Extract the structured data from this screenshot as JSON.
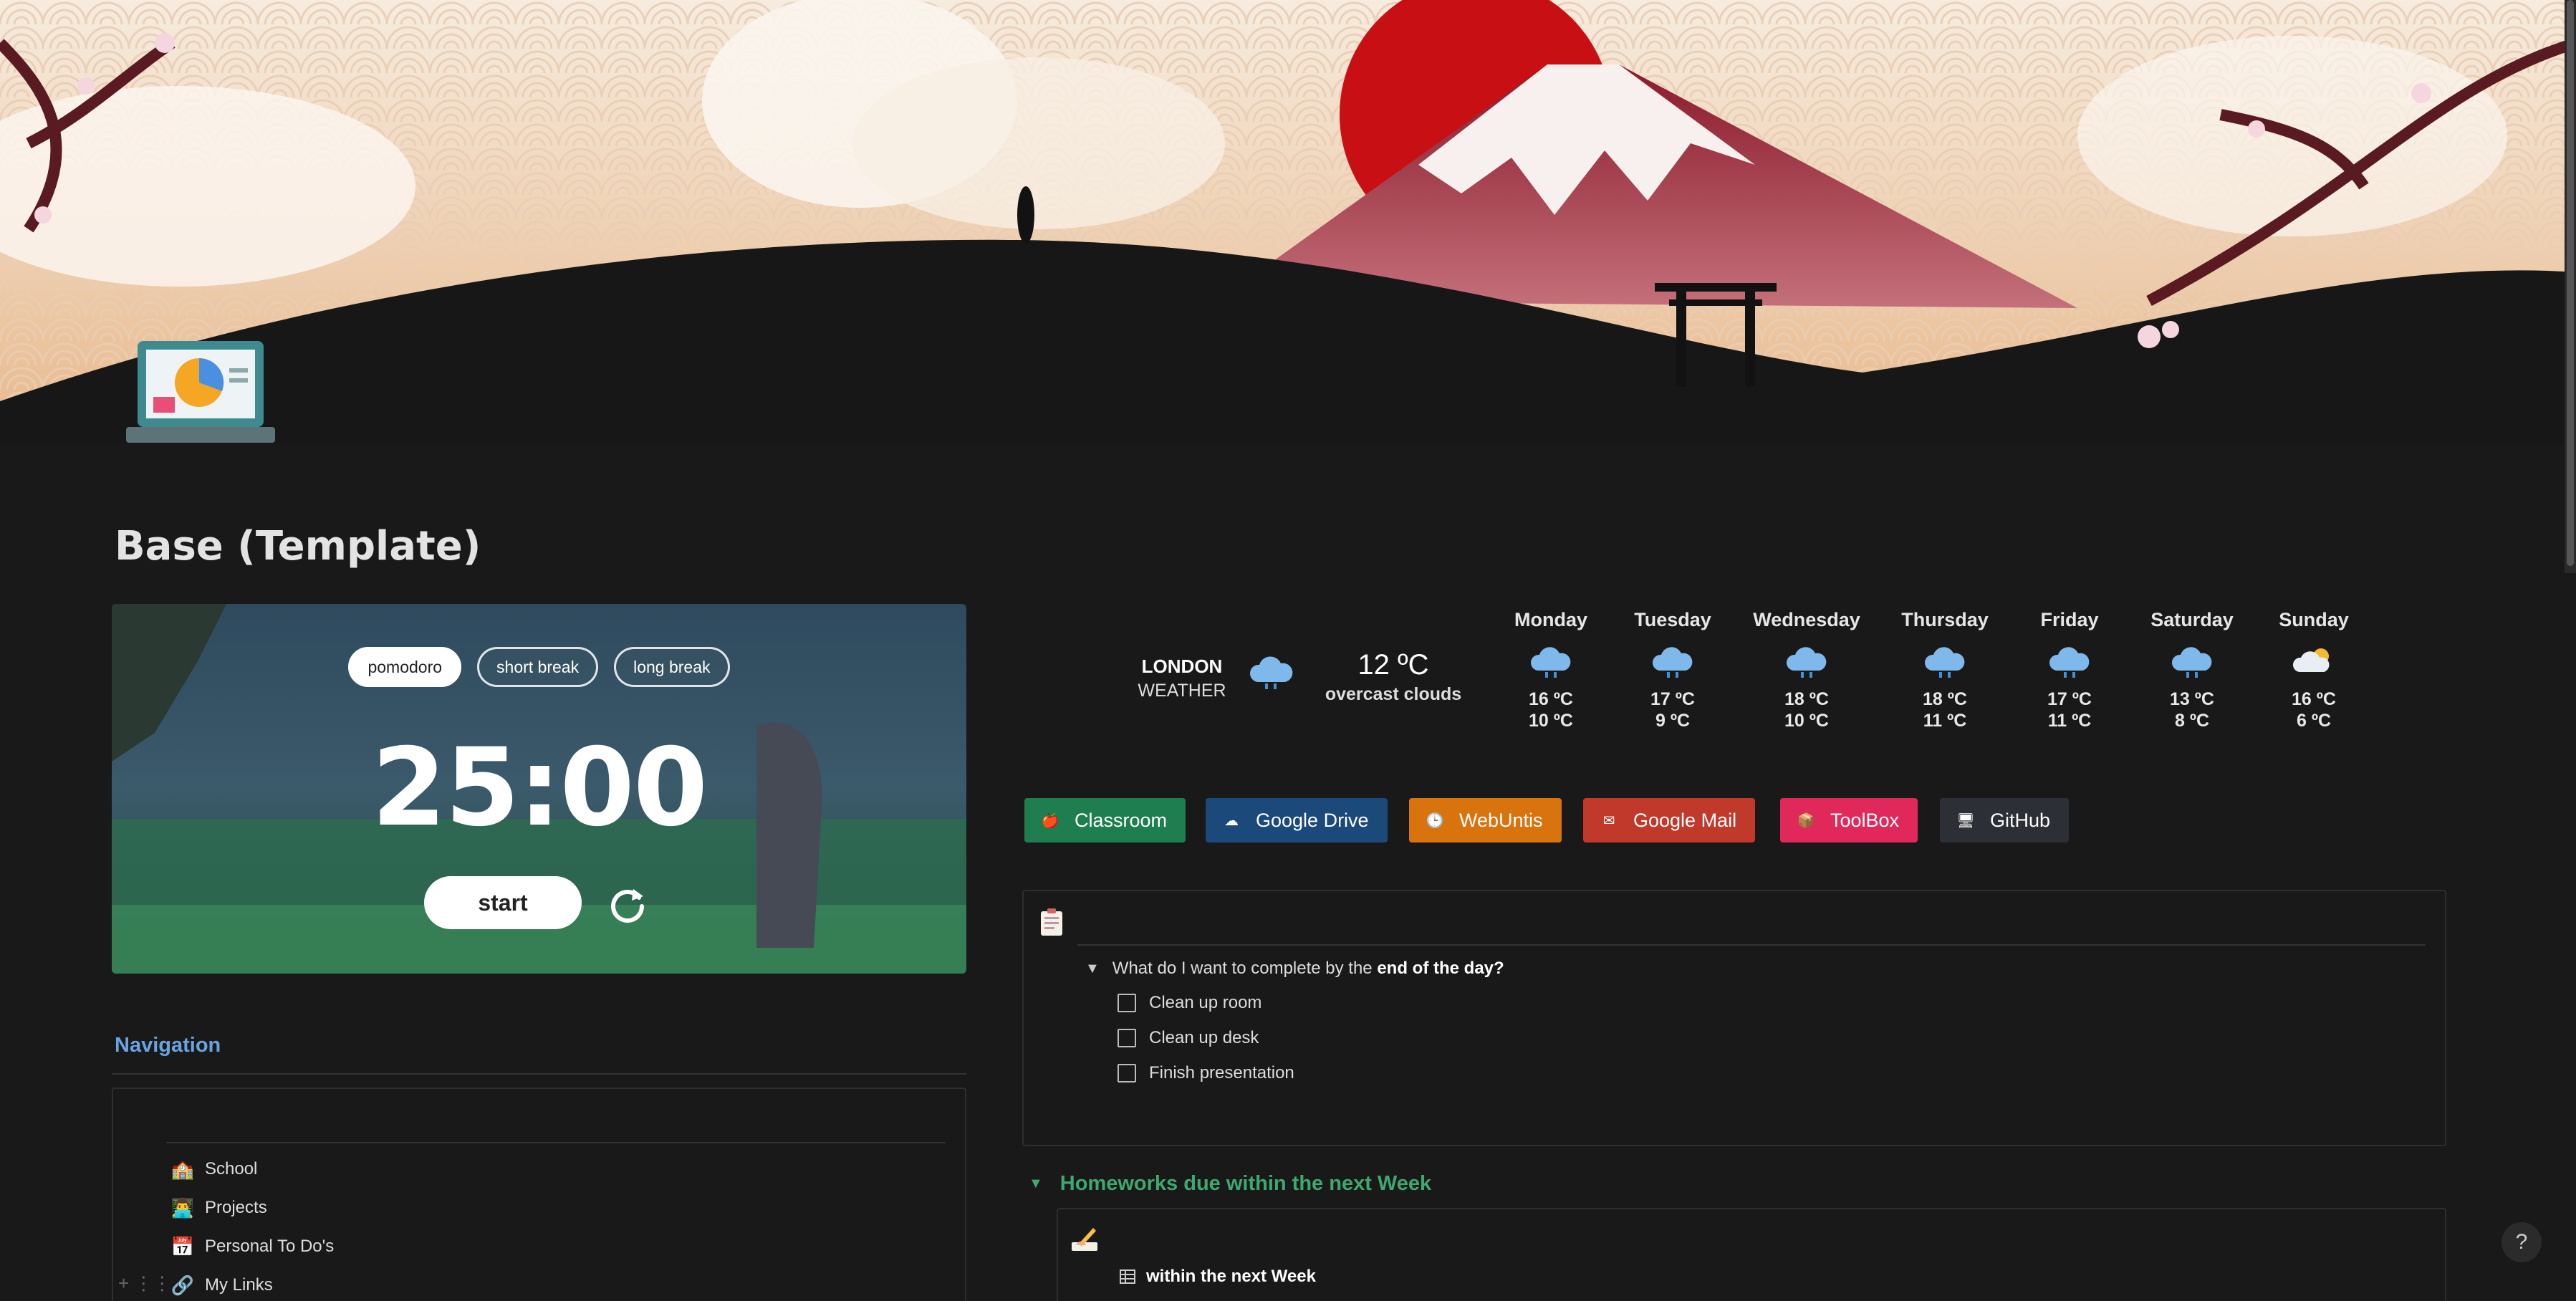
{
  "page": {
    "title": "Base (Template)"
  },
  "pomodoro": {
    "modes": [
      "pomodoro",
      "short break",
      "long break"
    ],
    "active_mode": "pomodoro",
    "time": "25:00",
    "start_label": "start"
  },
  "navigation": {
    "heading": "Navigation",
    "items": [
      {
        "label": "School",
        "icon": "school-icon"
      },
      {
        "label": "Projects",
        "icon": "projects-icon"
      },
      {
        "label": "Personal To Do's",
        "icon": "calendar-icon"
      },
      {
        "label": "My Links",
        "icon": "link-icon"
      }
    ]
  },
  "weather": {
    "city": "LONDON",
    "label": "WEATHER",
    "current_temp": "12 ºC",
    "current_desc": "overcast clouds",
    "days": [
      {
        "name": "Monday",
        "hi": "16 ºC",
        "lo": "10 ºC",
        "icon": "rain-cloud-icon"
      },
      {
        "name": "Tuesday",
        "hi": "17 ºC",
        "lo": "9 ºC",
        "icon": "rain-cloud-icon"
      },
      {
        "name": "Wednesday",
        "hi": "18 ºC",
        "lo": "10 ºC",
        "icon": "rain-cloud-icon"
      },
      {
        "name": "Thursday",
        "hi": "18 ºC",
        "lo": "11 ºC",
        "icon": "rain-cloud-icon"
      },
      {
        "name": "Friday",
        "hi": "17 ºC",
        "lo": "11 ºC",
        "icon": "rain-cloud-icon"
      },
      {
        "name": "Saturday",
        "hi": "13 ºC",
        "lo": "8 ºC",
        "icon": "rain-cloud-icon"
      },
      {
        "name": "Sunday",
        "hi": "16 ºC",
        "lo": "6 ºC",
        "icon": "sun-cloud-icon"
      }
    ]
  },
  "quick_links": [
    {
      "label": "Classroom",
      "color": "#1e7e4f",
      "icon": "apple-icon"
    },
    {
      "label": "Google Drive",
      "color": "#1b4a7a",
      "icon": "cloud-icon"
    },
    {
      "label": "WebUntis",
      "color": "#d9730d",
      "icon": "clock-icon"
    },
    {
      "label": "Google Mail",
      "color": "#c0392b",
      "icon": "mail-icon"
    },
    {
      "label": "ToolBox",
      "color": "#e0285a",
      "icon": "box-icon"
    },
    {
      "label": "GitHub",
      "color": "#2c2f36",
      "icon": "github-icon"
    }
  ],
  "todo": {
    "question_prefix": "What do I want to complete by the",
    "question_bold": "end of the day?",
    "tasks": [
      "Clean up room",
      "Clean up desk",
      "Finish presentation"
    ]
  },
  "homework": {
    "toggle_label": "Homeworks due within the next Week",
    "view_label": "within the next Week"
  },
  "help": {
    "label": "?"
  }
}
